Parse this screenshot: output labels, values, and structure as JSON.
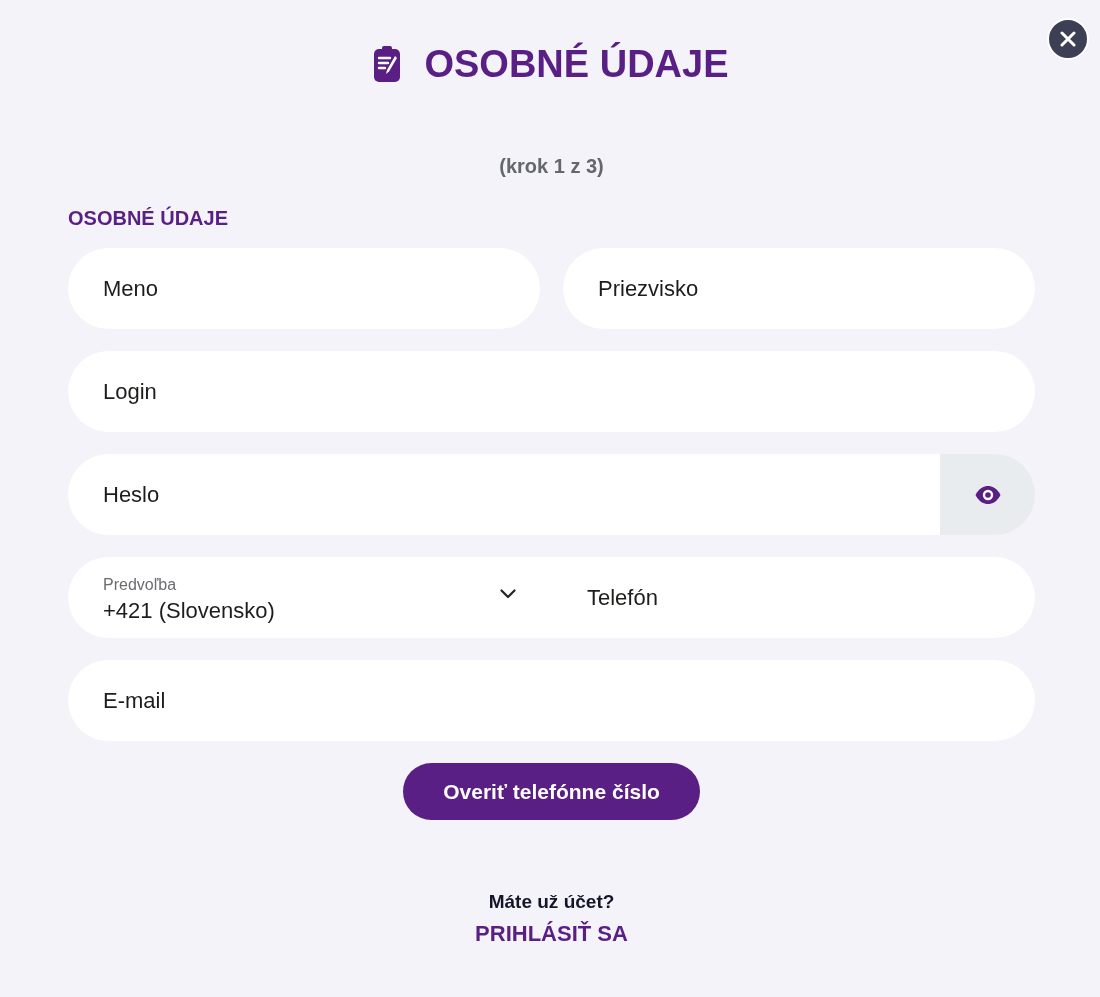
{
  "dialog": {
    "title": "OSOBNÉ ÚDAJE",
    "step": "(krok 1 z 3)"
  },
  "section": {
    "title": "OSOBNÉ ÚDAJE"
  },
  "rows": [
    {
      "kind": "split",
      "fields": [
        {
          "kind": "text",
          "placeholder": "Meno"
        },
        {
          "kind": "text",
          "placeholder": "Priezvisko"
        }
      ]
    },
    {
      "kind": "split",
      "fields": [
        {
          "kind": "text",
          "placeholder": "Login"
        }
      ]
    },
    {
      "kind": "split",
      "fields": [
        {
          "kind": "password",
          "placeholder": "Heslo"
        }
      ]
    },
    {
      "kind": "joined",
      "fields": [
        {
          "kind": "select",
          "label": "Predvoľba",
          "value": "+421 (Slovensko)"
        },
        {
          "kind": "text",
          "placeholder": "Telefón"
        }
      ]
    },
    {
      "kind": "split",
      "fields": [
        {
          "kind": "text",
          "placeholder": "E-mail"
        }
      ]
    }
  ],
  "submit_button": {
    "label": "Overiť telefónne číslo"
  },
  "footer": {
    "prompt": "Máte už účet?",
    "link": "PRIHLÁSIŤ SA"
  }
}
